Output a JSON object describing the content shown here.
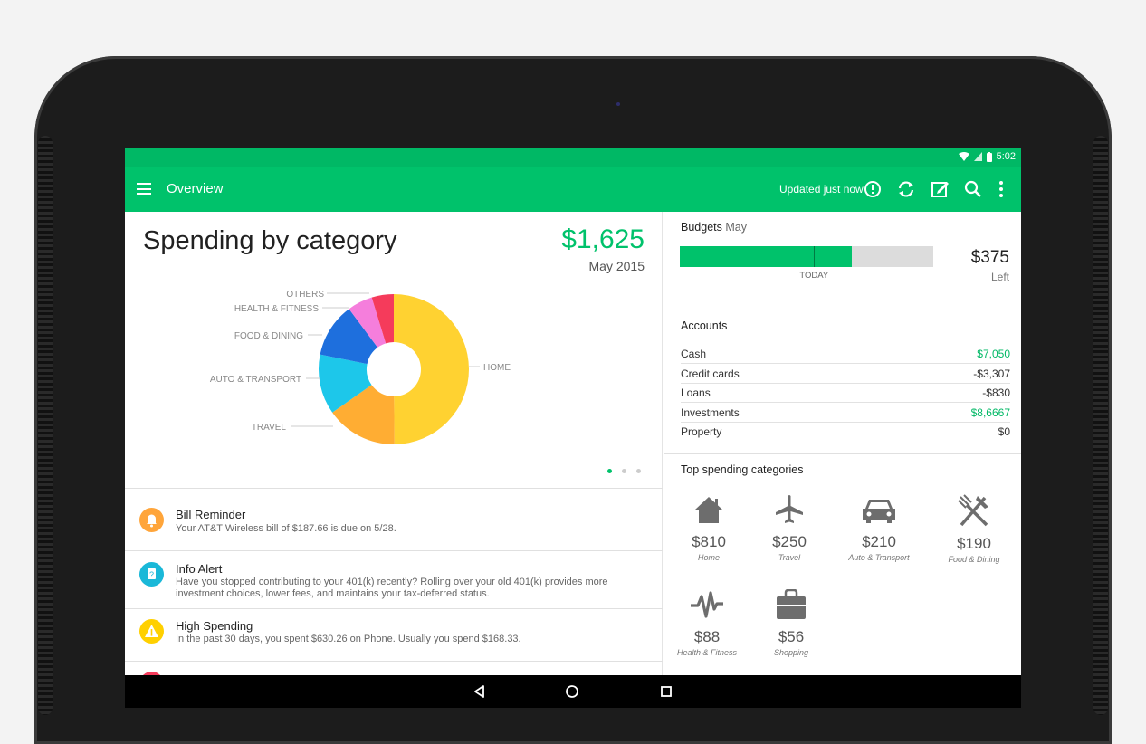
{
  "status": {
    "time": "5:02"
  },
  "appbar": {
    "title": "Overview",
    "updated": "Updated just now"
  },
  "chart": {
    "title": "Spending by category",
    "total": "$1,625",
    "date": "May 2015"
  },
  "chart_data": {
    "type": "pie",
    "categories": [
      "HOME",
      "TRAVEL",
      "AUTO & TRANSPORT",
      "FOOD & DINING",
      "HEALTH & FITNESS",
      "OTHERS"
    ],
    "values": [
      810,
      250,
      210,
      190,
      88,
      77
    ],
    "colors": [
      "#ffd231",
      "#ffad33",
      "#1dc7ea",
      "#1e6fdd",
      "#f57edc",
      "#f53b5b"
    ],
    "donut": true
  },
  "alerts": [
    {
      "title": "Bill Reminder",
      "text": "Your AT&T Wireless bill of $187.66 is due on 5/28.",
      "color": "#ffa53a",
      "icon": "bell-icon"
    },
    {
      "title": "Info Alert",
      "text": "Have you stopped contributing to your 401(k) recently? Rolling over your old 401(k) provides more investment choices, lower fees, and maintains your tax-deferred status.",
      "color": "#1ab8d8",
      "icon": "info-icon"
    },
    {
      "title": "High Spending",
      "text": "In the past 30 days, you spent $630.26 on Phone.  Usually you spend $168.33.",
      "color": "#ffd000",
      "icon": "warning-icon"
    }
  ],
  "budgets": {
    "title": "Budgets",
    "month": "May",
    "amount": "$375",
    "left_label": "Left",
    "today_label": "TODAY",
    "spent_fraction": 0.68,
    "today_fraction": 0.53
  },
  "accounts": {
    "title": "Accounts",
    "rows": [
      {
        "name": "Cash",
        "value": "$7,050",
        "color": "#00b865"
      },
      {
        "name": "Credit cards",
        "value": "-$3,307",
        "color": "#333333"
      },
      {
        "name": "Loans",
        "value": "-$830",
        "color": "#333333"
      },
      {
        "name": "Investments",
        "value": "$8,6667",
        "color": "#00b865"
      },
      {
        "name": "Property",
        "value": "$0",
        "color": "#333333"
      }
    ]
  },
  "top_categories": {
    "title": "Top spending categories",
    "items": [
      {
        "amount": "$810",
        "label": "Home",
        "icon": "home-icon"
      },
      {
        "amount": "$250",
        "label": "Travel",
        "icon": "airplane-icon"
      },
      {
        "amount": "$210",
        "label": "Auto & Transport",
        "icon": "car-icon"
      },
      {
        "amount": "$190",
        "label": "Food & Dining",
        "icon": "fork-knife-icon"
      },
      {
        "amount": "$88",
        "label": "Health & Fitness",
        "icon": "heartbeat-icon"
      },
      {
        "amount": "$56",
        "label": "Shopping",
        "icon": "shopping-bag-icon"
      }
    ]
  }
}
